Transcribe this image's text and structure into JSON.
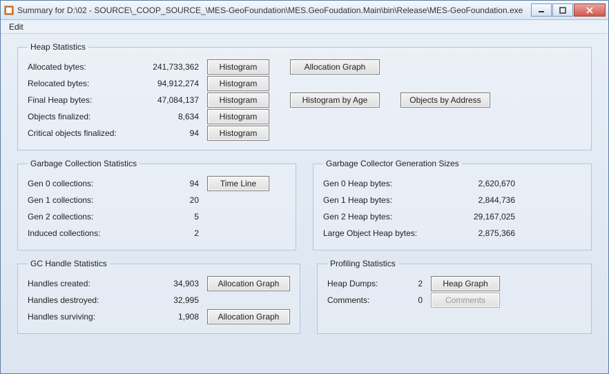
{
  "window": {
    "title": "Summary for D:\\02 - SOURCE\\_COOP_SOURCE_\\MES-GeoFoundation\\MES.GeoFoudation.Main\\bin\\Release\\MES-GeoFoundation.exe"
  },
  "menu": {
    "edit": "Edit"
  },
  "heap": {
    "legend": "Heap Statistics",
    "rows": {
      "allocated": {
        "label": "Allocated bytes:",
        "value": "241,733,362",
        "btn": "Histogram"
      },
      "relocated": {
        "label": "Relocated bytes:",
        "value": "94,912,274",
        "btn": "Histogram"
      },
      "final": {
        "label": "Final Heap bytes:",
        "value": "47,084,137",
        "btn": "Histogram"
      },
      "objfin": {
        "label": "Objects finalized:",
        "value": "8,634",
        "btn": "Histogram"
      },
      "critfin": {
        "label": "Critical objects finalized:",
        "value": "94",
        "btn": "Histogram"
      }
    },
    "allocation_graph": "Allocation Graph",
    "histogram_by_age": "Histogram by Age",
    "objects_by_address": "Objects by Address"
  },
  "gc": {
    "legend": "Garbage Collection Statistics",
    "gen0": {
      "label": "Gen 0 collections:",
      "value": "94"
    },
    "gen1": {
      "label": "Gen 1 collections:",
      "value": "20"
    },
    "gen2": {
      "label": "Gen 2 collections:",
      "value": "5"
    },
    "induced": {
      "label": "Induced collections:",
      "value": "2"
    },
    "timeline": "Time Line"
  },
  "gensizes": {
    "legend": "Garbage Collector Generation Sizes",
    "gen0": {
      "label": "Gen 0 Heap bytes:",
      "value": "2,620,670"
    },
    "gen1": {
      "label": "Gen 1 Heap bytes:",
      "value": "2,844,736"
    },
    "gen2": {
      "label": "Gen 2 Heap bytes:",
      "value": "29,167,025"
    },
    "loh": {
      "label": "Large Object Heap bytes:",
      "value": "2,875,366"
    }
  },
  "handles": {
    "legend": "GC Handle Statistics",
    "created": {
      "label": "Handles created:",
      "value": "34,903",
      "btn": "Allocation Graph"
    },
    "destroyed": {
      "label": "Handles destroyed:",
      "value": "32,995"
    },
    "surviving": {
      "label": "Handles surviving:",
      "value": "1,908",
      "btn": "Allocation Graph"
    }
  },
  "profiling": {
    "legend": "Profiling Statistics",
    "dumps": {
      "label": "Heap Dumps:",
      "value": "2",
      "btn": "Heap Graph"
    },
    "comments": {
      "label": "Comments:",
      "value": "0",
      "btn": "Comments"
    }
  }
}
